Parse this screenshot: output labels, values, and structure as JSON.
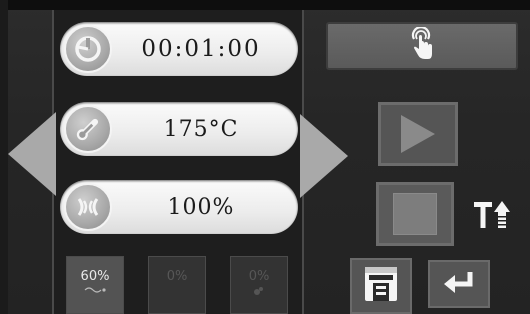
{
  "controls": {
    "timer": {
      "value": "00:01:00",
      "icon": "timer-icon"
    },
    "temperature": {
      "value": "175°C",
      "icon": "thermometer-icon"
    },
    "fan": {
      "value": "100%",
      "icon": "fan-airflow-icon"
    }
  },
  "tiles": [
    {
      "value": "60%",
      "icon": "fan-sub-icon",
      "active": true
    },
    {
      "value": "0%",
      "icon": "",
      "active": false
    },
    {
      "value": "0%",
      "icon": "steam-icon",
      "active": false
    }
  ],
  "buttons": {
    "touch": {
      "icon": "touch-hand-icon"
    },
    "start": {
      "icon": "play-icon"
    },
    "stop": {
      "icon": "stop-icon"
    },
    "text_size": {
      "icon": "text-size-icon"
    },
    "save": {
      "icon": "save-floppy-icon"
    },
    "back": {
      "icon": "return-arrow-icon"
    }
  },
  "colors": {
    "background": "#262626",
    "pill": "#f2f2f2",
    "arrow": "#a9a9a9",
    "button": "#555555"
  }
}
